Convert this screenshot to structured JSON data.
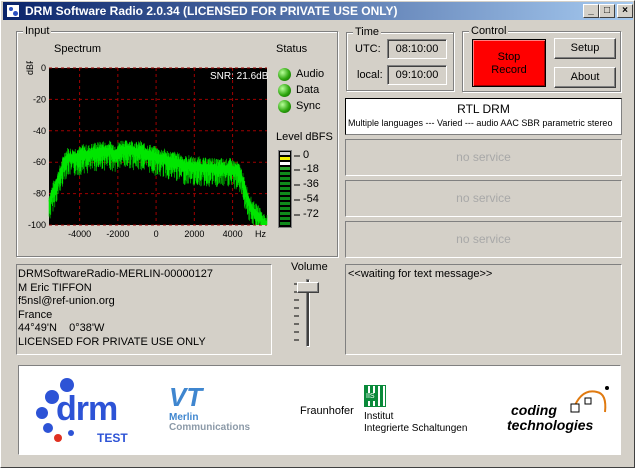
{
  "window": {
    "title": "DRM Software Radio 2.0.34 (LICENSED FOR PRIVATE USE ONLY)",
    "min": "_",
    "max": "□",
    "close": "×"
  },
  "input": {
    "group_label": "Input",
    "spectrum_label": "Spectrum",
    "snr": "SNR: 21.6dB",
    "y_unit": "dBFS",
    "x_unit": "Hz",
    "y_ticks": [
      "0",
      "-20",
      "-40",
      "-60",
      "-80",
      "-100"
    ],
    "x_ticks": [
      "-4000",
      "-2000",
      "0",
      "2000",
      "4000"
    ]
  },
  "status": {
    "label": "Status",
    "items": [
      "Audio",
      "Data",
      "Sync"
    ]
  },
  "level": {
    "label": "Level dBFS",
    "ticks": [
      "0",
      "-18",
      "-36",
      "-54",
      "-72"
    ]
  },
  "time": {
    "group_label": "Time",
    "utc_label": "UTC:",
    "utc_value": "08:10:00",
    "local_label": "local:",
    "local_value": "09:10:00"
  },
  "control": {
    "group_label": "Control",
    "stop_record": "Stop\nRecord",
    "setup": "Setup",
    "about": "About"
  },
  "services": {
    "active": {
      "name": "RTL DRM",
      "details": "Multiple languages --- Varied --- audio AAC SBR parametric stereo"
    },
    "empty": [
      "no service",
      "no service",
      "no service"
    ]
  },
  "info": {
    "lines": [
      "DRMSoftwareRadio-MERLIN-00000127",
      "M Eric TIFFON",
      "f5nsl@ref-union.org",
      "France",
      "44°49'N    0°38'W",
      "LICENSED FOR PRIVATE USE ONLY"
    ]
  },
  "volume": {
    "label": "Volume",
    "level": 0.95
  },
  "text_message": "<<waiting for text message>>",
  "logos": {
    "drm": "drm",
    "drm_test": "TEST",
    "vt": "VT",
    "merlin_line1": "Merlin",
    "merlin_line2": "Communications",
    "fraunhofer": "Fraunhofer",
    "iis": "IIS",
    "institut_line1": "Institut",
    "institut_line2": "Integrierte Schaltungen",
    "coding_line1": "coding",
    "coding_line2": "technologies"
  },
  "chart_data": {
    "type": "line",
    "title": "",
    "xlabel": "Hz",
    "ylabel": "dBFS",
    "xlim": [
      -5600,
      5800
    ],
    "ylim": [
      -100,
      0
    ],
    "grid": true,
    "series": [
      {
        "x": [
          -5600,
          -5400,
          -5200,
          -5000,
          -4800,
          -4600,
          -4400,
          -4200,
          -4000,
          -3800,
          -3600,
          -3400,
          -3200,
          -3000,
          -2800,
          -2600,
          -2400,
          -2200,
          -2000,
          -1800,
          -1600,
          -1400,
          -1200,
          -1000,
          -800,
          -600,
          -400,
          -200,
          0,
          200,
          400,
          600,
          800,
          1000,
          1200,
          1400,
          1600,
          1800,
          2000,
          2200,
          2400,
          2600,
          2800,
          3000,
          3200,
          3400,
          3600,
          3800,
          4000,
          4200,
          4400,
          4600,
          4800,
          5000,
          5200,
          5400,
          5600,
          5800
        ],
        "values": [
          -85,
          -78,
          -72,
          -66,
          -58,
          -55,
          -56,
          -55,
          -55,
          -53,
          -54,
          -53,
          -52,
          -52,
          -51,
          -52,
          -51,
          -53,
          -52,
          -50,
          -51,
          -50,
          -51,
          -52,
          -51,
          -53,
          -53,
          -54,
          -55,
          -56,
          -56,
          -57,
          -58,
          -58,
          -59,
          -60,
          -61,
          -60,
          -62,
          -61,
          -62,
          -62,
          -62,
          -62,
          -63,
          -62,
          -63,
          -62,
          -63,
          -64,
          -66,
          -74,
          -82,
          -88,
          -91,
          -93,
          -97,
          -98
        ]
      }
    ]
  }
}
